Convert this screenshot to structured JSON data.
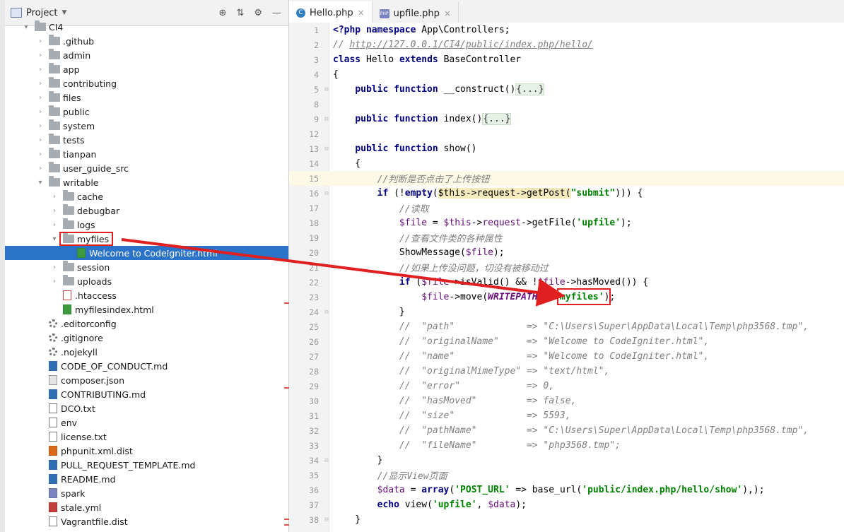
{
  "project_panel": {
    "title": "Project",
    "tree": [
      {
        "label": "CI4",
        "kind": "folder",
        "expanded": true,
        "depth": 0
      },
      {
        "label": ".github",
        "kind": "folder",
        "depth": 1
      },
      {
        "label": "admin",
        "kind": "folder",
        "depth": 1
      },
      {
        "label": "app",
        "kind": "folder",
        "depth": 1
      },
      {
        "label": "contributing",
        "kind": "folder",
        "depth": 1
      },
      {
        "label": "files",
        "kind": "folder",
        "depth": 1
      },
      {
        "label": "public",
        "kind": "folder",
        "depth": 1
      },
      {
        "label": "system",
        "kind": "folder",
        "depth": 1
      },
      {
        "label": "tests",
        "kind": "folder",
        "depth": 1
      },
      {
        "label": "tianpan",
        "kind": "folder",
        "depth": 1
      },
      {
        "label": "user_guide_src",
        "kind": "folder",
        "depth": 1
      },
      {
        "label": "writable",
        "kind": "folder",
        "expanded": true,
        "depth": 1
      },
      {
        "label": "cache",
        "kind": "folder",
        "depth": 2
      },
      {
        "label": "debugbar",
        "kind": "folder",
        "depth": 2
      },
      {
        "label": "logs",
        "kind": "folder",
        "depth": 2
      },
      {
        "label": "myfiles",
        "kind": "folder",
        "expanded": true,
        "depth": 2
      },
      {
        "label": "Welcome to CodeIgniter.html",
        "kind": "html",
        "depth": 3,
        "selected": true
      },
      {
        "label": "session",
        "kind": "folder",
        "depth": 2
      },
      {
        "label": "uploads",
        "kind": "folder",
        "depth": 2
      },
      {
        "label": ".htaccess",
        "kind": "htaccess",
        "depth": 2
      },
      {
        "label": "myfilesindex.html",
        "kind": "html",
        "depth": 2
      },
      {
        "label": ".editorconfig",
        "kind": "gear",
        "depth": 1
      },
      {
        "label": ".gitignore",
        "kind": "gear",
        "depth": 1
      },
      {
        "label": ".nojekyll",
        "kind": "gear",
        "depth": 1
      },
      {
        "label": "CODE_OF_CONDUCT.md",
        "kind": "md",
        "depth": 1
      },
      {
        "label": "composer.json",
        "kind": "json",
        "depth": 1
      },
      {
        "label": "CONTRIBUTING.md",
        "kind": "md",
        "depth": 1
      },
      {
        "label": "DCO.txt",
        "kind": "txt",
        "depth": 1
      },
      {
        "label": "env",
        "kind": "txt",
        "depth": 1
      },
      {
        "label": "license.txt",
        "kind": "txt",
        "depth": 1
      },
      {
        "label": "phpunit.xml.dist",
        "kind": "xml",
        "depth": 1
      },
      {
        "label": "PULL_REQUEST_TEMPLATE.md",
        "kind": "md",
        "depth": 1
      },
      {
        "label": "README.md",
        "kind": "md",
        "depth": 1
      },
      {
        "label": "spark",
        "kind": "php",
        "depth": 1
      },
      {
        "label": "stale.yml",
        "kind": "yml",
        "depth": 1
      },
      {
        "label": "Vagrantfile.dist",
        "kind": "txt",
        "depth": 1
      }
    ]
  },
  "tabs": [
    {
      "label": "Hello.php",
      "icon": "php-class-icon",
      "active": true
    },
    {
      "label": "upfile.php",
      "icon": "php-file-icon",
      "active": false
    }
  ],
  "editor": {
    "current_line": 15,
    "lines": [
      {
        "n": "1",
        "tokens": [
          [
            "kw",
            "<?php "
          ],
          [
            "kw",
            "namespace "
          ],
          [
            "fn",
            "App\\Controllers;"
          ]
        ]
      },
      {
        "n": "2",
        "tokens": [
          [
            "cm",
            "// "
          ],
          [
            "cm-url",
            "http://127.0.0.1/CI4/public/index.php/hello/"
          ]
        ]
      },
      {
        "n": "3",
        "tokens": [
          [
            "kw",
            "class "
          ],
          [
            "fn",
            "Hello "
          ],
          [
            "kw",
            "extends "
          ],
          [
            "fn",
            "BaseController"
          ]
        ]
      },
      {
        "n": "4",
        "tokens": [
          [
            "fn",
            "{"
          ]
        ]
      },
      {
        "n": "5",
        "tokens": [
          [
            "fn",
            "    "
          ],
          [
            "kw",
            "public function "
          ],
          [
            "fn",
            "__construct()"
          ],
          [
            "fold-txt",
            "{...}"
          ]
        ]
      },
      {
        "n": "8",
        "tokens": []
      },
      {
        "n": "9",
        "tokens": [
          [
            "fn",
            "    "
          ],
          [
            "kw",
            "public function "
          ],
          [
            "fn",
            "index()"
          ],
          [
            "fold-txt",
            "{...}"
          ]
        ]
      },
      {
        "n": "12",
        "tokens": []
      },
      {
        "n": "13",
        "tokens": [
          [
            "fn",
            "    "
          ],
          [
            "kw",
            "public function "
          ],
          [
            "fn",
            "show()"
          ]
        ]
      },
      {
        "n": "14",
        "tokens": [
          [
            "fn",
            "    {"
          ]
        ]
      },
      {
        "n": "15",
        "tokens": [
          [
            "fn",
            "        "
          ],
          [
            "cm",
            "//判断是否点击了上传按钮"
          ]
        ]
      },
      {
        "n": "16",
        "tokens": [
          [
            "fn",
            "        "
          ],
          [
            "kw",
            "if "
          ],
          [
            "fn",
            "(!"
          ],
          [
            "kw",
            "empty"
          ],
          [
            "fn",
            "("
          ],
          [
            "hl",
            "$this->request->getPost("
          ],
          [
            "str",
            "\"submit\""
          ],
          [
            "fn",
            ")"
          ],
          [
            "fn",
            ")) {"
          ]
        ]
      },
      {
        "n": "17",
        "tokens": [
          [
            "fn",
            "            "
          ],
          [
            "cm",
            "//读取"
          ]
        ]
      },
      {
        "n": "18",
        "tokens": [
          [
            "fn",
            "            "
          ],
          [
            "var",
            "$file "
          ],
          [
            "fn",
            "= "
          ],
          [
            "var",
            "$this"
          ],
          [
            "fn",
            "->"
          ],
          [
            "var",
            "request"
          ],
          [
            "fn",
            "->getFile("
          ],
          [
            "str",
            "'upfile'"
          ],
          [
            "fn",
            ");"
          ]
        ]
      },
      {
        "n": "19",
        "tokens": [
          [
            "fn",
            "            "
          ],
          [
            "cm",
            "//查看文件类的各种属性"
          ]
        ]
      },
      {
        "n": "20",
        "tokens": [
          [
            "fn",
            "            ShowMessage("
          ],
          [
            "var",
            "$file"
          ],
          [
            "fn",
            ");"
          ]
        ]
      },
      {
        "n": "21",
        "tokens": [
          [
            "fn",
            "            "
          ],
          [
            "cm",
            "//如果上传没问题，切没有被移动过"
          ]
        ]
      },
      {
        "n": "22",
        "tokens": [
          [
            "fn",
            "            "
          ],
          [
            "kw",
            "if "
          ],
          [
            "fn",
            "("
          ],
          [
            "var",
            "$file"
          ],
          [
            "fn",
            "->isValid() && !"
          ],
          [
            "var",
            "$file"
          ],
          [
            "fn",
            "->hasMoved()) {"
          ]
        ]
      },
      {
        "n": "23",
        "tokens": [
          [
            "fn",
            "                "
          ],
          [
            "var",
            "$file"
          ],
          [
            "fn",
            "->move("
          ],
          [
            "const",
            "WRITEPATH"
          ],
          [
            "fn",
            " . "
          ],
          [
            "str",
            "'myfiles'"
          ],
          [
            "fn",
            ");"
          ]
        ]
      },
      {
        "n": "24",
        "tokens": [
          [
            "fn",
            "            }"
          ]
        ]
      },
      {
        "n": "25",
        "tokens": [
          [
            "fn",
            "            "
          ],
          [
            "cm",
            "//  \"path\"             => \"C:\\Users\\Super\\AppData\\Local\\Temp\\php3568.tmp\","
          ]
        ]
      },
      {
        "n": "26",
        "tokens": [
          [
            "fn",
            "            "
          ],
          [
            "cm",
            "//  \"originalName\"     => \"Welcome to CodeIgniter.html\","
          ]
        ]
      },
      {
        "n": "27",
        "tokens": [
          [
            "fn",
            "            "
          ],
          [
            "cm",
            "//  \"name\"             => \"Welcome to CodeIgniter.html\","
          ]
        ]
      },
      {
        "n": "28",
        "tokens": [
          [
            "fn",
            "            "
          ],
          [
            "cm",
            "//  \"originalMimeType\" => \"text/html\","
          ]
        ]
      },
      {
        "n": "29",
        "tokens": [
          [
            "fn",
            "            "
          ],
          [
            "cm",
            "//  \"error\"            => 0,"
          ]
        ]
      },
      {
        "n": "30",
        "tokens": [
          [
            "fn",
            "            "
          ],
          [
            "cm",
            "//  \"hasMoved\"         => false,"
          ]
        ]
      },
      {
        "n": "31",
        "tokens": [
          [
            "fn",
            "            "
          ],
          [
            "cm",
            "//  \"size\"             => 5593,"
          ]
        ]
      },
      {
        "n": "32",
        "tokens": [
          [
            "fn",
            "            "
          ],
          [
            "cm",
            "//  \"pathName\"         => \"C:\\Users\\Super\\AppData\\Local\\Temp\\php3568.tmp\","
          ]
        ]
      },
      {
        "n": "33",
        "tokens": [
          [
            "fn",
            "            "
          ],
          [
            "cm",
            "//  \"fileName\"         => \"php3568.tmp\";"
          ]
        ]
      },
      {
        "n": "34",
        "tokens": [
          [
            "fn",
            "        }"
          ]
        ]
      },
      {
        "n": "35",
        "tokens": [
          [
            "fn",
            "        "
          ],
          [
            "cm",
            "//显示View页面"
          ]
        ]
      },
      {
        "n": "36",
        "tokens": [
          [
            "fn",
            "        "
          ],
          [
            "var",
            "$data "
          ],
          [
            "fn",
            "= "
          ],
          [
            "kw",
            "array"
          ],
          [
            "fn",
            "("
          ],
          [
            "str",
            "'POST_URL'"
          ],
          [
            "fn",
            " => base_url("
          ],
          [
            "str",
            "'public/index.php/hello/show'"
          ],
          [
            "fn",
            "),);"
          ]
        ]
      },
      {
        "n": "37",
        "tokens": [
          [
            "fn",
            "        "
          ],
          [
            "kw",
            "echo "
          ],
          [
            "fn",
            "view("
          ],
          [
            "str",
            "'upfile'"
          ],
          [
            "fn",
            ", "
          ],
          [
            "var",
            "$data"
          ],
          [
            "fn",
            ");"
          ]
        ]
      },
      {
        "n": "38",
        "tokens": [
          [
            "fn",
            "    }"
          ]
        ]
      }
    ]
  }
}
